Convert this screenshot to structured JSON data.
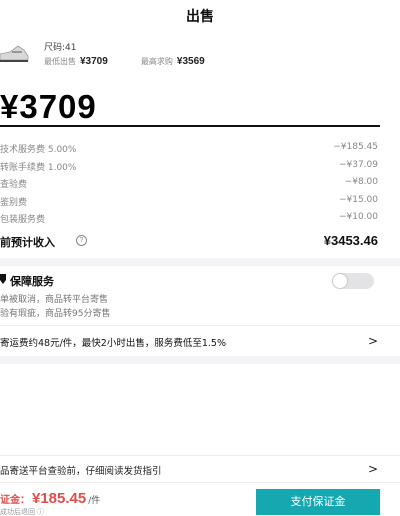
{
  "header": {
    "title": "出售"
  },
  "product": {
    "size_label": "尺码:41",
    "lowest_ask_label": "最低出售",
    "lowest_ask_value": "¥3709",
    "highest_bid_label": "最高求购",
    "highest_bid_value": "¥3569"
  },
  "listing": {
    "price": "¥3709"
  },
  "fees": [
    {
      "label": "技术服务费 5.00%",
      "value": "−¥185.45"
    },
    {
      "label": "转账手续费 1.00%",
      "value": "−¥37.09"
    },
    {
      "label": "查验费",
      "value": "−¥8.00"
    },
    {
      "label": "鉴别费",
      "value": "−¥15.00"
    },
    {
      "label": "包装服务费",
      "value": "−¥10.00"
    }
  ],
  "net_income": {
    "label": "前预计收入",
    "value": "¥3453.46"
  },
  "guarantee": {
    "title": "保障服务",
    "desc1": "单被取消，商品转平台寄售",
    "desc2": "验有瑕疵，商品转95分寄售",
    "toggle_on": false
  },
  "express": {
    "text": "寄运费约48元/件，最快2小时出售，服务费低至1.5%"
  },
  "guide": {
    "text": "品寄送平台查验前，仔细阅读发货指引"
  },
  "footer": {
    "deposit_label": "证金：",
    "deposit_amount": "¥185.45",
    "deposit_unit": "/件",
    "refund_note": "成功后退回",
    "pay_button": "支付保证金"
  },
  "colors": {
    "accent": "#15a8b0",
    "deposit_red": "#e14d4d"
  },
  "icons": [
    "shoe-thumbnail",
    "help-icon",
    "shield-icon",
    "chevron-right-icon",
    "info-icon"
  ]
}
